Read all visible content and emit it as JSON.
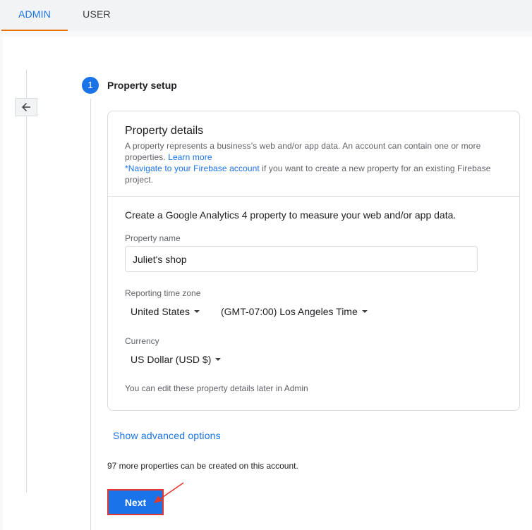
{
  "tabs": [
    {
      "label": "ADMIN",
      "active": true
    },
    {
      "label": "USER",
      "active": false
    }
  ],
  "back_button": {
    "icon": "arrow-left-icon"
  },
  "stepper": {
    "number": "1",
    "title": "Property setup"
  },
  "card": {
    "title": "Property details",
    "description": "A property represents a business’s web and/or app data. An account can contain one or more properties.",
    "learn_more": "Learn more",
    "firebase_link": "*Navigate to your Firebase account",
    "firebase_rest": "if you want to create a new property for an existing Firebase project.",
    "intro": "Create a Google Analytics 4 property to measure your web and/or app data.",
    "property_name": {
      "label": "Property name",
      "value": "Juliet's shop"
    },
    "timezone": {
      "label": "Reporting time zone",
      "country": "United States",
      "zone": "(GMT-07:00) Los Angeles Time"
    },
    "currency": {
      "label": "Currency",
      "value": "US Dollar (USD $)"
    },
    "note": "You can edit these property details later in Admin"
  },
  "advanced_options": "Show advanced options",
  "more_properties": "97 more properties can be created on this account.",
  "next_button": "Next",
  "colors": {
    "accent": "#1a73e8",
    "tab_underline": "#e8710a",
    "highlight": "#e03a2f"
  }
}
